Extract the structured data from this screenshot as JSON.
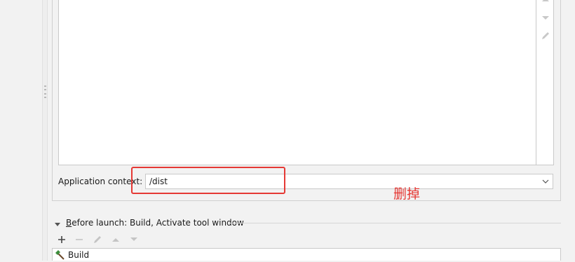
{
  "context": {
    "label": "Application context:",
    "value": "/dist"
  },
  "annotation": {
    "text": "删掉",
    "color": "#e53935"
  },
  "before_launch": {
    "mnemonic": "B",
    "title_rest": "efore launch: Build, Activate tool window",
    "tasks": [
      {
        "label": "Build",
        "icon": "hammer-icon"
      }
    ]
  },
  "icons": {
    "side_toolbar": [
      "move-up-icon",
      "move-down-icon",
      "edit-icon"
    ],
    "before_launch_toolbar": [
      "add-icon",
      "remove-icon",
      "edit-icon",
      "move-up-icon",
      "move-down-icon"
    ]
  }
}
